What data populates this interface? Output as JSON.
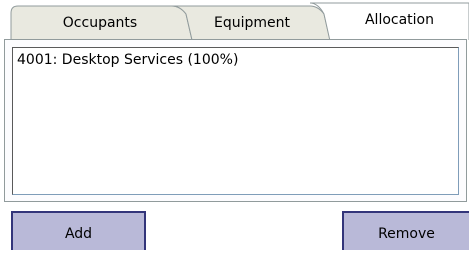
{
  "tabs": [
    {
      "label": "Occupants",
      "active": false
    },
    {
      "label": "Equipment",
      "active": false
    },
    {
      "label": "Allocation",
      "active": true
    }
  ],
  "allocation_list": {
    "items": [
      "4001: Desktop Services  (100%)"
    ]
  },
  "buttons": {
    "add_label": "Add",
    "remove_label": "Remove"
  },
  "colors": {
    "tab_inactive_fill": "#e9e9e0",
    "tab_border": "#919b9c",
    "button_fill": "#b9b9d8",
    "button_border": "#33357a"
  }
}
